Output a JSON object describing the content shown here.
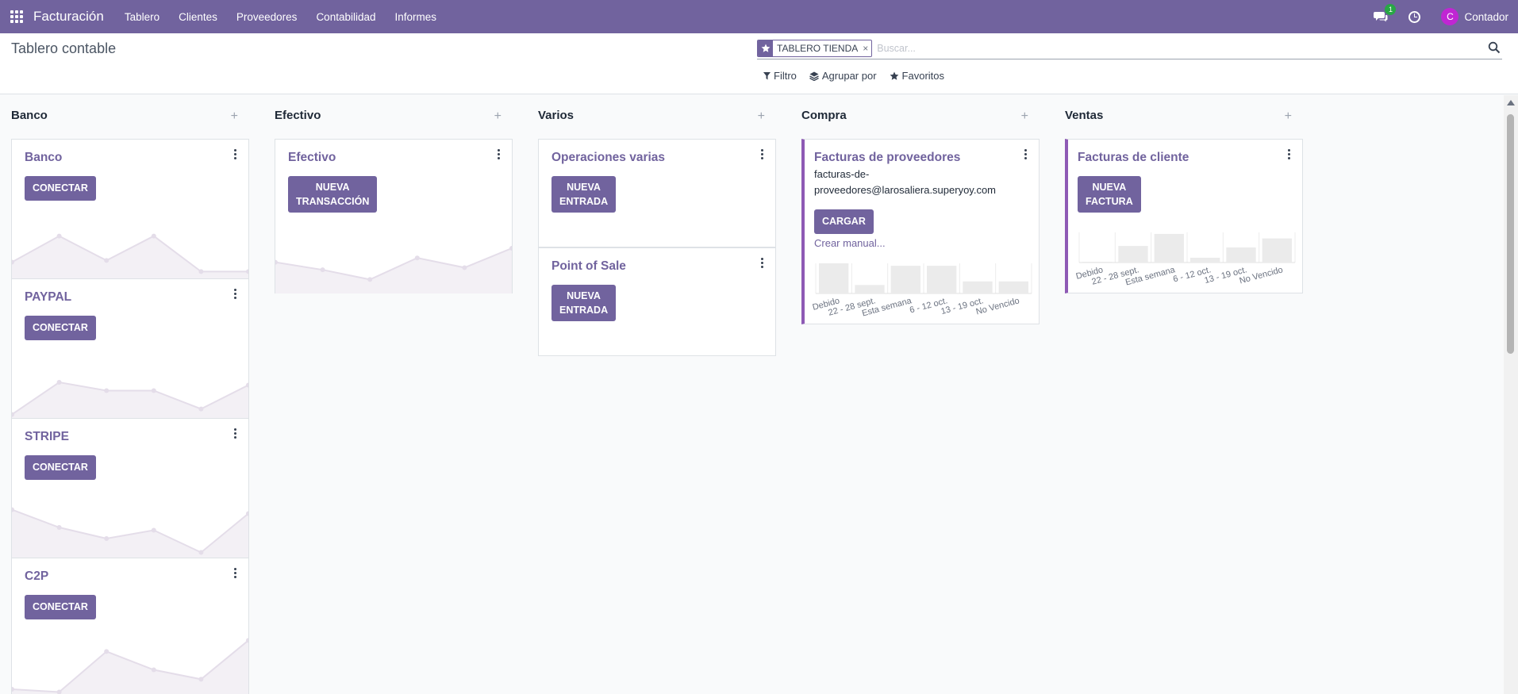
{
  "navbar": {
    "app_name": "Facturación",
    "menu": [
      "Tablero",
      "Clientes",
      "Proveedores",
      "Contabilidad",
      "Informes"
    ],
    "messages_count": "1",
    "user_initial": "C",
    "user_name": "Contador"
  },
  "control_panel": {
    "title": "Tablero contable",
    "facet": "TABLERO TIENDA",
    "facet_close": "×",
    "search_placeholder": "Buscar...",
    "filter_label": "Filtro",
    "group_label": "Agrupar por",
    "favorites_label": "Favoritos"
  },
  "columns": [
    {
      "title": "Banco",
      "add": "+"
    },
    {
      "title": "Efectivo",
      "add": "+"
    },
    {
      "title": "Varios",
      "add": "+"
    },
    {
      "title": "Compra",
      "add": "+"
    },
    {
      "title": "Ventas",
      "add": "+"
    }
  ],
  "cards": {
    "banco": {
      "title": "Banco",
      "button": "CONECTAR"
    },
    "paypal": {
      "title": "PAYPAL",
      "button": "CONECTAR"
    },
    "stripe": {
      "title": "STRIPE",
      "button": "CONECTAR"
    },
    "c2p": {
      "title": "C2P",
      "button": "CONECTAR"
    },
    "efectivo": {
      "title": "Efectivo",
      "button_line1": "NUEVA",
      "button_line2": "TRANSACCIÓN"
    },
    "operaciones": {
      "title": "Operaciones varias",
      "button_line1": "NUEVA",
      "button_line2": "ENTRADA"
    },
    "pos": {
      "title": "Point of Sale",
      "button_line1": "NUEVA",
      "button_line2": "ENTRADA"
    },
    "proveedores": {
      "title": "Facturas de proveedores",
      "email_line1": "facturas-de-",
      "email_line2": "proveedores@larosaliera.superyoy.com",
      "button": "CARGAR",
      "link": "Crear manual..."
    },
    "cliente": {
      "title": "Facturas de cliente",
      "button_line1": "NUEVA",
      "button_line2": "FACTURA"
    }
  },
  "bar_categories": [
    "Debido",
    "22 - 28 sept.",
    "Esta semana",
    "6 - 12 oct.",
    "13 - 19 oct.",
    "No Vencido"
  ],
  "colors": {
    "brand": "#71639e",
    "accent_bar": "#8e5ab5",
    "badge": "#28a745",
    "avatar": "#c026d3"
  },
  "chart_data": [
    {
      "type": "line",
      "card": "Banco",
      "values": [
        0.25,
        0.72,
        0.28,
        0.72,
        0.08,
        0.08
      ],
      "fill": true
    },
    {
      "type": "line",
      "card": "PAYPAL",
      "values": [
        0.02,
        0.6,
        0.45,
        0.45,
        0.12,
        0.55
      ],
      "fill": true
    },
    {
      "type": "line",
      "card": "STRIPE",
      "values": [
        0.82,
        0.5,
        0.3,
        0.45,
        0.05,
        0.75
      ],
      "fill": true
    },
    {
      "type": "line",
      "card": "C2P",
      "values": [
        0.1,
        0.05,
        0.78,
        0.45,
        0.28,
        0.98
      ],
      "fill": true
    },
    {
      "type": "line",
      "card": "Efectivo",
      "values": [
        0.52,
        0.38,
        0.2,
        0.6,
        0.42,
        0.78
      ],
      "fill": true
    },
    {
      "type": "bar",
      "card": "Facturas de proveedores",
      "categories": [
        "Debido",
        "22 - 28 sept.",
        "Esta semana",
        "6 - 12 oct.",
        "13 - 19 oct.",
        "No Vencido"
      ],
      "values": [
        1.0,
        0.28,
        0.92,
        0.92,
        0.4,
        0.4
      ]
    },
    {
      "type": "bar",
      "card": "Facturas de cliente",
      "categories": [
        "Debido",
        "22 - 28 sept.",
        "Esta semana",
        "6 - 12 oct.",
        "13 - 19 oct.",
        "No Vencido"
      ],
      "values": [
        0.02,
        0.55,
        0.95,
        0.16,
        0.5,
        0.8
      ]
    }
  ]
}
